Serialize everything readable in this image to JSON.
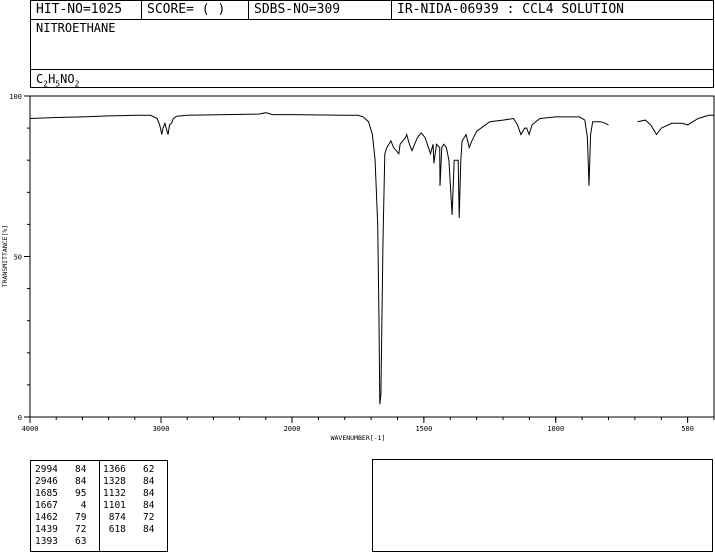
{
  "header": {
    "hit_no": "HIT-NO=1025",
    "score": "SCORE=  (  )",
    "sdbs_no": "SDBS-NO=309",
    "ir_id": "IR-NIDA-06939 : CCL4 SOLUTION"
  },
  "compound": {
    "name": "NITROETHANE",
    "formula": {
      "c": "C",
      "c_n": "2",
      "h": "H",
      "h_n": "5",
      "n": "N",
      "o": "O",
      "o_n": "2"
    }
  },
  "chart_data": {
    "type": "line",
    "xlabel": "WAVENUMBER[-1]",
    "ylabel": "TRANSMITTANCE[%]",
    "xlim": [
      4000,
      400
    ],
    "ylim": [
      0,
      100
    ],
    "x_ticks": [
      "4000",
      "3000",
      "2000",
      "1500",
      "1000",
      "500"
    ],
    "y_ticks": [
      "100",
      "50",
      "0"
    ],
    "segments": [
      [
        [
          4000,
          93
        ],
        [
          3800,
          93.3
        ],
        [
          3600,
          93.5
        ],
        [
          3400,
          93.8
        ],
        [
          3200,
          94
        ],
        [
          3080,
          94
        ],
        [
          3030,
          93
        ],
        [
          3010,
          91
        ],
        [
          2994,
          88
        ],
        [
          2985,
          90
        ],
        [
          2970,
          91.5
        ],
        [
          2960,
          90
        ],
        [
          2946,
          88
        ],
        [
          2935,
          91
        ],
        [
          2920,
          91.5
        ],
        [
          2905,
          93
        ],
        [
          2880,
          93.7
        ],
        [
          2800,
          94
        ],
        [
          2500,
          94.2
        ],
        [
          2250,
          94.4
        ],
        [
          2200,
          94.8
        ],
        [
          2150,
          94.2
        ],
        [
          2000,
          94.2
        ],
        [
          1800,
          94
        ],
        [
          1750,
          94
        ],
        [
          1730,
          93.5
        ],
        [
          1710,
          92
        ],
        [
          1695,
          88
        ],
        [
          1685,
          80
        ],
        [
          1675,
          60
        ],
        [
          1670,
          30
        ],
        [
          1667,
          4
        ],
        [
          1663,
          7
        ],
        [
          1655,
          55
        ],
        [
          1648,
          82
        ],
        [
          1640,
          84
        ],
        [
          1625,
          86
        ],
        [
          1615,
          84
        ],
        [
          1605,
          83
        ],
        [
          1595,
          82
        ],
        [
          1590,
          85
        ],
        [
          1580,
          86
        ],
        [
          1570,
          87
        ],
        [
          1565,
          88
        ],
        [
          1555,
          85
        ],
        [
          1545,
          83
        ],
        [
          1525,
          87
        ],
        [
          1510,
          88.5
        ],
        [
          1495,
          87
        ],
        [
          1475,
          82
        ],
        [
          1465,
          85
        ],
        [
          1462,
          79
        ],
        [
          1452,
          85
        ],
        [
          1440,
          84
        ],
        [
          1439,
          72
        ],
        [
          1432,
          84
        ],
        [
          1425,
          85
        ],
        [
          1415,
          84
        ],
        [
          1405,
          80
        ],
        [
          1393,
          63
        ],
        [
          1385,
          80
        ],
        [
          1370,
          80
        ],
        [
          1366,
          62
        ],
        [
          1360,
          80
        ],
        [
          1355,
          86
        ],
        [
          1340,
          88
        ],
        [
          1328,
          84
        ],
        [
          1318,
          86
        ],
        [
          1300,
          89
        ],
        [
          1250,
          92
        ],
        [
          1200,
          92.5
        ],
        [
          1160,
          93
        ],
        [
          1145,
          91
        ],
        [
          1132,
          88
        ],
        [
          1118,
          90
        ],
        [
          1110,
          90
        ],
        [
          1101,
          88
        ],
        [
          1090,
          91
        ],
        [
          1060,
          93
        ],
        [
          1000,
          93.5
        ],
        [
          950,
          93.5
        ],
        [
          910,
          93.5
        ],
        [
          890,
          92.5
        ],
        [
          880,
          87
        ],
        [
          874,
          72
        ],
        [
          868,
          88
        ],
        [
          860,
          92
        ],
        [
          830,
          92
        ],
        [
          812,
          91.5
        ],
        [
          800,
          91
        ]
      ],
      [
        [
          690,
          92
        ],
        [
          660,
          92.5
        ],
        [
          640,
          91
        ],
        [
          618,
          88
        ],
        [
          600,
          90
        ],
        [
          560,
          91.5
        ],
        [
          520,
          91.5
        ],
        [
          500,
          91
        ],
        [
          480,
          92
        ],
        [
          460,
          93
        ],
        [
          440,
          93.5
        ],
        [
          420,
          94
        ],
        [
          400,
          94
        ]
      ]
    ],
    "grid": false,
    "peak_table": [
      {
        "wavenumber": "2994",
        "transmittance": "84"
      },
      {
        "wavenumber": "2946",
        "transmittance": "84"
      },
      {
        "wavenumber": "1685",
        "transmittance": "95"
      },
      {
        "wavenumber": "1667",
        "transmittance": "4"
      },
      {
        "wavenumber": "1462",
        "transmittance": "79"
      },
      {
        "wavenumber": "1439",
        "transmittance": "72"
      },
      {
        "wavenumber": "1393",
        "transmittance": "63"
      },
      {
        "wavenumber": "1366",
        "transmittance": "62"
      },
      {
        "wavenumber": "1328",
        "transmittance": "84"
      },
      {
        "wavenumber": "1132",
        "transmittance": "84"
      },
      {
        "wavenumber": "1101",
        "transmittance": "84"
      },
      {
        "wavenumber": "874",
        "transmittance": "72"
      },
      {
        "wavenumber": "618",
        "transmittance": "84"
      }
    ]
  }
}
